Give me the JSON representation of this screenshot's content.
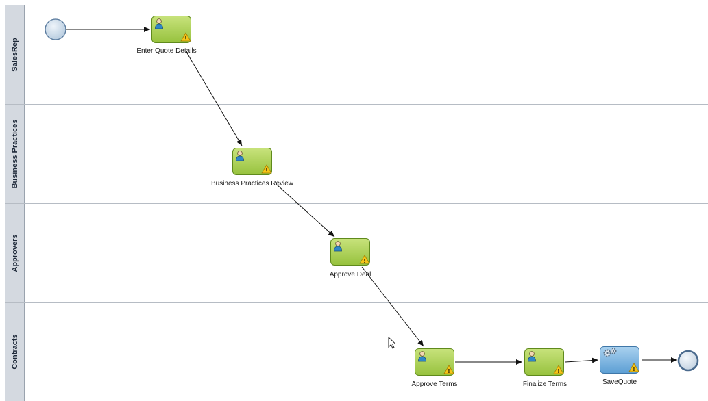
{
  "lanes": [
    {
      "name": "SalesRep"
    },
    {
      "name": "Business Practices"
    },
    {
      "name": "Approvers"
    },
    {
      "name": "Contracts"
    }
  ],
  "tasks": [
    {
      "id": "enter-quote-details",
      "label": "Enter Quote Details",
      "kind": "user",
      "warning": true
    },
    {
      "id": "business-practices-review",
      "label": "Business Practices Review",
      "kind": "user",
      "warning": true
    },
    {
      "id": "approve-deal",
      "label": "Approve Deal",
      "kind": "user",
      "warning": true
    },
    {
      "id": "approve-terms",
      "label": "Approve Terms",
      "kind": "user",
      "warning": true
    },
    {
      "id": "finalize-terms",
      "label": "Finalize Terms",
      "kind": "user",
      "warning": true
    },
    {
      "id": "savequote",
      "label": "SaveQuote",
      "kind": "service",
      "warning": true
    }
  ],
  "events": [
    {
      "id": "start-event",
      "kind": "start"
    },
    {
      "id": "end-event",
      "kind": "end"
    }
  ],
  "flows": [
    [
      "start-event",
      "enter-quote-details"
    ],
    [
      "enter-quote-details",
      "business-practices-review"
    ],
    [
      "business-practices-review",
      "approve-deal"
    ],
    [
      "approve-deal",
      "approve-terms"
    ],
    [
      "approve-terms",
      "finalize-terms"
    ],
    [
      "finalize-terms",
      "savequote"
    ],
    [
      "savequote",
      "end-event"
    ]
  ],
  "colors": {
    "user_task_fill": "#a8cf4f",
    "service_task_fill": "#6fb0df",
    "warning_fill": "#f5c518",
    "lane_header_fill": "#d4d9e0"
  }
}
